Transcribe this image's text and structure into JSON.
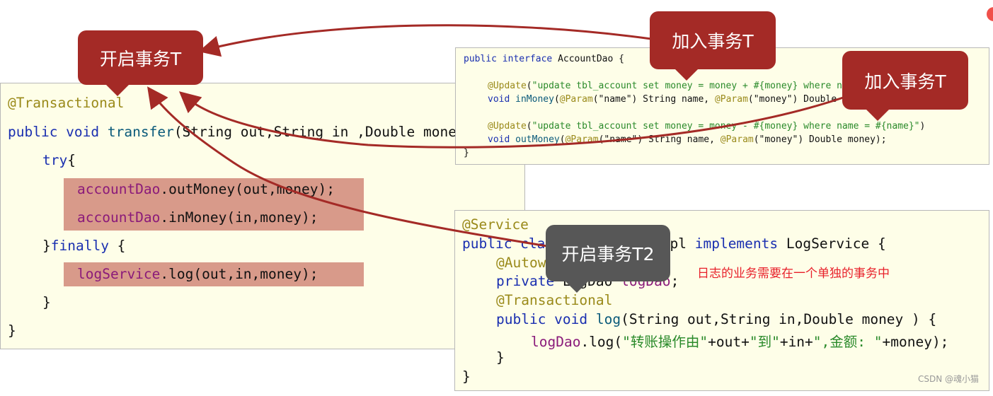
{
  "left_code": {
    "l1": "@Transactional",
    "l2a": "public void ",
    "l2b": "transfer",
    "l2c": "(String out,String in ,Double money) {",
    "l3": "try",
    "l3b": "{",
    "l4a": "accountDao",
    "l4b": ".outMoney(out,money);",
    "l5a": "accountDao",
    "l5b": ".inMoney(in,money);",
    "l6a": "}",
    "l6b": "finally",
    "l6c": " {",
    "l7a": "logService",
    "l7b": ".log(out,in,money);",
    "l8": "}",
    "l9": "}"
  },
  "dao_code": {
    "l1a": "public interface ",
    "l1b": "AccountDao {",
    "l2a": "@Update",
    "l2b": "(",
    "l2c": "\"update tbl_account set money = money + #{money} where name = #{name}\"",
    "l2d": ")",
    "l3a": "void ",
    "l3b": "inMoney",
    "l3c": "(",
    "l3d": "@Param",
    "l3e": "(\"name\")",
    "l3f": " String name, ",
    "l3g": "@Param",
    "l3h": "(\"money\")",
    "l3i": " Double money);",
    "l4a": "@Update",
    "l4b": "(",
    "l4c": "\"update tbl_account set money = money - #{money} where name = #{name}\"",
    "l4d": ")",
    "l5a": "void ",
    "l5b": "outMoney",
    "l5c": "(",
    "l5d": "@Param",
    "l5e": "(\"name\")",
    "l5f": " String name, ",
    "l5g": "@Param",
    "l5h": "(\"money\")",
    "l5i": " Double money);",
    "l6": "}"
  },
  "svc_code": {
    "l1": "@Service",
    "l2a": "public class ",
    "l2b": "LogServiceImpl ",
    "l2c": "implements ",
    "l2d": "LogService {",
    "l3": "@Autowired",
    "l4a": "private ",
    "l4b": "LogDao ",
    "l4c": "logDao",
    "l4d": ";",
    "l5": "@Transactional",
    "l6a": "public void ",
    "l6b": "log",
    "l6c": "(String out,String in,Double money ) {",
    "l7a": "logDao",
    "l7b": ".log(",
    "l7c": "\"转账操作由\"",
    "l7d": "+out+",
    "l7e": "\"到\"",
    "l7f": "+in+",
    "l7g": "\",金额: \"",
    "l7h": "+money);",
    "l8": "}",
    "l9": "}"
  },
  "callouts": {
    "start_t": "开启事务T",
    "join_t_1": "加入事务T",
    "join_t_2": "加入事务T",
    "start_t2": "开启事务T2"
  },
  "note": "日志的业务需要在一个单独的事务中",
  "watermark": "CSDN @魂小猫",
  "colors": {
    "callout_red": "#a42a26",
    "callout_gray": "#575757",
    "arrow": "#a42a26",
    "note": "#e8202a",
    "panel_bg": "#fefee8"
  }
}
